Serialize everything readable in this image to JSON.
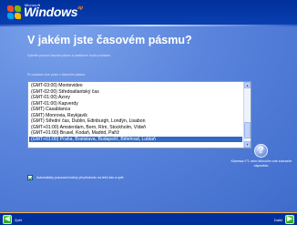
{
  "header": {
    "brand_small": "Microsoft",
    "brand_word": "Windows",
    "brand_suffix": "xp"
  },
  "page": {
    "title": "V jakém jste časovém pásmu?",
    "subtitle": "Vyberte pomocí časové pásmo a nastavení hodin počítače.",
    "list_label": "Po ukázání více pozic v časovém pásmu:"
  },
  "timezones": [
    "(GMT-03:00) Montevideo",
    "(GMT-02:00) Středoatlantský čas",
    "(GMT-01:00) Azory",
    "(GMT-01:00) Kapverdy",
    "(GMT) Casablanca",
    "(GMT) Monrovia, Reykjavík",
    "(GMT) Střední čas, Dublin, Edinburgh, Londýn, Lisabon",
    "(GMT+01:00) Amsterdam, Bern, Řím, Stockholm, Vídeň",
    "(GMT+01:00) Brusel, Kodaň, Madrid, Paříž",
    "(GMT+01:00) Praha, Bratislava, Budapešť, Bělehrad, Lublaň"
  ],
  "selected_index": 9,
  "checkbox": {
    "checked": true,
    "label": "Automaticky posunout hodiny při přechodu na letní čas a zpět"
  },
  "help": {
    "glyph": "?",
    "text": "Klávesou F1 nebo kliknutím zde zobrazíte nápovědu."
  },
  "nav": {
    "back_label": "Zpět",
    "next_label": "Další",
    "back_glyph": "◀",
    "next_glyph": "▶"
  },
  "colors": {
    "top_bar": "#00309c",
    "content_bg": "#5a84dc",
    "selection": "#316ac5",
    "accent_line": "#ffb24a",
    "nav_button": "#24a31a"
  },
  "icons": {
    "logo": "windows-flag-icon",
    "help": "help-icon",
    "back": "back-arrow-icon",
    "next": "next-arrow-icon",
    "check": "checkmark-icon"
  }
}
